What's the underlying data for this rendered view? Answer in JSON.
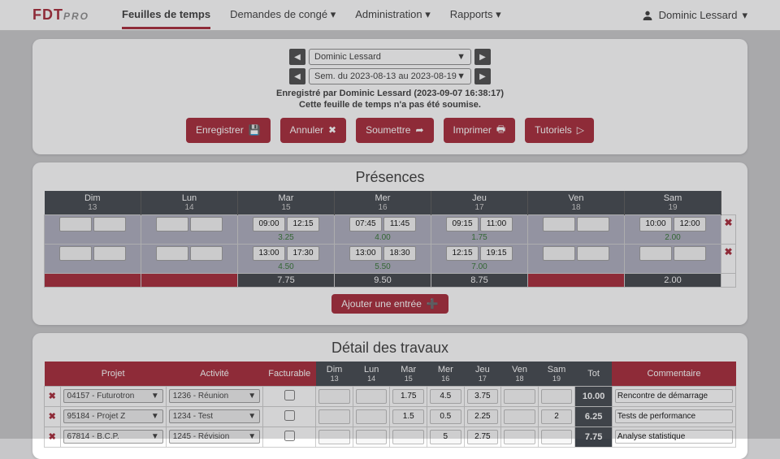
{
  "nav": {
    "items": [
      "Feuilles de temps",
      "Demandes de congé",
      "Administration",
      "Rapports"
    ],
    "active": 0
  },
  "user": "Dominic Lessard",
  "selectors": {
    "employee": "Dominic Lessard",
    "week": "Sem. du 2023-08-13 au 2023-08-19"
  },
  "status": {
    "line1": "Enregistré par Dominic Lessard (2023-09-07 16:38:17)",
    "line2": "Cette feuille de temps n'a pas été soumise."
  },
  "buttons": {
    "save": "Enregistrer",
    "cancel": "Annuler",
    "submit": "Soumettre",
    "print": "Imprimer",
    "tutorials": "Tutoriels",
    "add_entry": "Ajouter une entrée"
  },
  "presences": {
    "title": "Présences",
    "days": [
      {
        "label": "Dim",
        "num": "13"
      },
      {
        "label": "Lun",
        "num": "14"
      },
      {
        "label": "Mar",
        "num": "15"
      },
      {
        "label": "Mer",
        "num": "16"
      },
      {
        "label": "Jeu",
        "num": "17"
      },
      {
        "label": "Ven",
        "num": "18"
      },
      {
        "label": "Sam",
        "num": "19"
      }
    ],
    "rows": [
      {
        "cells": [
          null,
          null,
          {
            "in": "09:00",
            "out": "12:15",
            "sub": "3.25"
          },
          {
            "in": "07:45",
            "out": "11:45",
            "sub": "4.00"
          },
          {
            "in": "09:15",
            "out": "11:00",
            "sub": "1.75"
          },
          null,
          {
            "in": "10:00",
            "out": "12:00",
            "sub": "2.00"
          }
        ]
      },
      {
        "cells": [
          null,
          null,
          {
            "in": "13:00",
            "out": "17:30",
            "sub": "4.50"
          },
          {
            "in": "13:00",
            "out": "18:30",
            "sub": "5.50"
          },
          {
            "in": "12:15",
            "out": "19:15",
            "sub": "7.00"
          },
          null,
          null
        ]
      }
    ],
    "totals": [
      "",
      "",
      "7.75",
      "9.50",
      "8.75",
      "",
      "2.00"
    ]
  },
  "details": {
    "title": "Détail des travaux",
    "headers": {
      "project": "Projet",
      "activity": "Activité",
      "billable": "Facturable",
      "total": "Tot",
      "comment": "Commentaire"
    },
    "days": [
      {
        "label": "Dim",
        "num": "13"
      },
      {
        "label": "Lun",
        "num": "14"
      },
      {
        "label": "Mar",
        "num": "15"
      },
      {
        "label": "Mer",
        "num": "16"
      },
      {
        "label": "Jeu",
        "num": "17"
      },
      {
        "label": "Ven",
        "num": "18"
      },
      {
        "label": "Sam",
        "num": "19"
      }
    ],
    "rows": [
      {
        "project": "04157 - Futurotron",
        "activity": "1236 - Réunion",
        "billable": false,
        "hours": [
          "",
          "",
          "1.75",
          "4.5",
          "3.75",
          "",
          ""
        ],
        "total": "10.00",
        "comment": "Rencontre de démarrage"
      },
      {
        "project": "95184 - Projet Z",
        "activity": "1234 - Test",
        "billable": false,
        "hours": [
          "",
          "",
          "1.5",
          "0.5",
          "2.25",
          "",
          "2"
        ],
        "total": "6.25",
        "comment": "Tests de performance"
      },
      {
        "project": "67814 - B.C.P.",
        "activity": "1245 - Révision",
        "billable": false,
        "hours": [
          "",
          "",
          "",
          "5",
          "2.75",
          "",
          ""
        ],
        "total": "7.75",
        "comment": "Analyse statistique"
      }
    ]
  }
}
